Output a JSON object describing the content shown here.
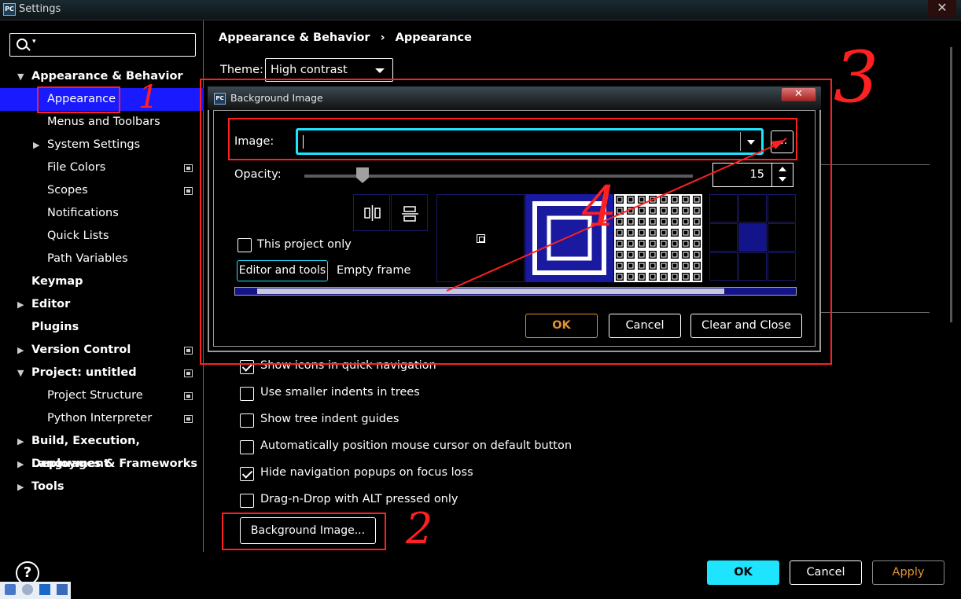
{
  "window": {
    "title": "Settings",
    "app_icon": "PC"
  },
  "search": {
    "placeholder": ""
  },
  "sidebar": {
    "items": [
      {
        "label": "Appearance & Behavior",
        "bold": true,
        "arrow": "expanded"
      },
      {
        "label": "Appearance",
        "selected": true
      },
      {
        "label": "Menus and Toolbars"
      },
      {
        "label": "System Settings",
        "arrow": "collapsed"
      },
      {
        "label": "File Colors",
        "project_icon": true
      },
      {
        "label": "Scopes",
        "project_icon": true
      },
      {
        "label": "Notifications"
      },
      {
        "label": "Quick Lists"
      },
      {
        "label": "Path Variables"
      },
      {
        "label": "Keymap",
        "bold": true
      },
      {
        "label": "Editor",
        "bold": true,
        "arrow": "collapsed"
      },
      {
        "label": "Plugins",
        "bold": true
      },
      {
        "label": "Version Control",
        "bold": true,
        "arrow": "collapsed",
        "project_icon": true
      },
      {
        "label": "Project: untitled",
        "bold": true,
        "arrow": "expanded",
        "project_icon": true
      },
      {
        "label": "Project Structure",
        "project_icon": true
      },
      {
        "label": "Python Interpreter",
        "project_icon": true
      },
      {
        "label": "Build, Execution, Deployment",
        "bold": true,
        "arrow": "collapsed"
      },
      {
        "label": "Languages & Frameworks",
        "bold": true,
        "arrow": "collapsed"
      },
      {
        "label": "Tools",
        "bold": true,
        "arrow": "collapsed"
      }
    ]
  },
  "breadcrumb": {
    "parent": "Appearance & Behavior",
    "separator": "›",
    "current": "Appearance"
  },
  "theme": {
    "label": "Theme:",
    "value": "High contrast"
  },
  "options": [
    {
      "label": "Show icons in quick navigation",
      "checked": true
    },
    {
      "label": "Use smaller indents in trees",
      "checked": false
    },
    {
      "label": "Show tree indent guides",
      "checked": false
    },
    {
      "label": "Automatically position mouse cursor on default button",
      "checked": false
    },
    {
      "label": "Hide navigation popups on focus loss",
      "checked": true
    },
    {
      "label": "Drag-n-Drop with ALT pressed only",
      "checked": false
    }
  ],
  "background_image_button": "Background Image...",
  "footer": {
    "help": "?",
    "ok": "OK",
    "cancel": "Cancel",
    "apply": "Apply"
  },
  "dialog": {
    "title": "Background Image",
    "close": "✕",
    "image_label": "Image:",
    "image_value": "",
    "browse": "...",
    "opacity_label": "Opacity:",
    "opacity_value": "15",
    "opacity": 15,
    "this_project_only": "This project only",
    "this_project_only_checked": false,
    "editor_and_tools": "Editor and tools",
    "empty_frame": "Empty frame",
    "anchor_selected": "center",
    "ok": "OK",
    "cancel": "Cancel",
    "clear_and_close": "Clear and Close"
  },
  "annotations": [
    "1",
    "2",
    "3",
    "4"
  ],
  "colors": {
    "accent": "#1ee4ff",
    "selection": "#1a1aff",
    "annotation": "#ff2020",
    "apply": "#e29230"
  }
}
